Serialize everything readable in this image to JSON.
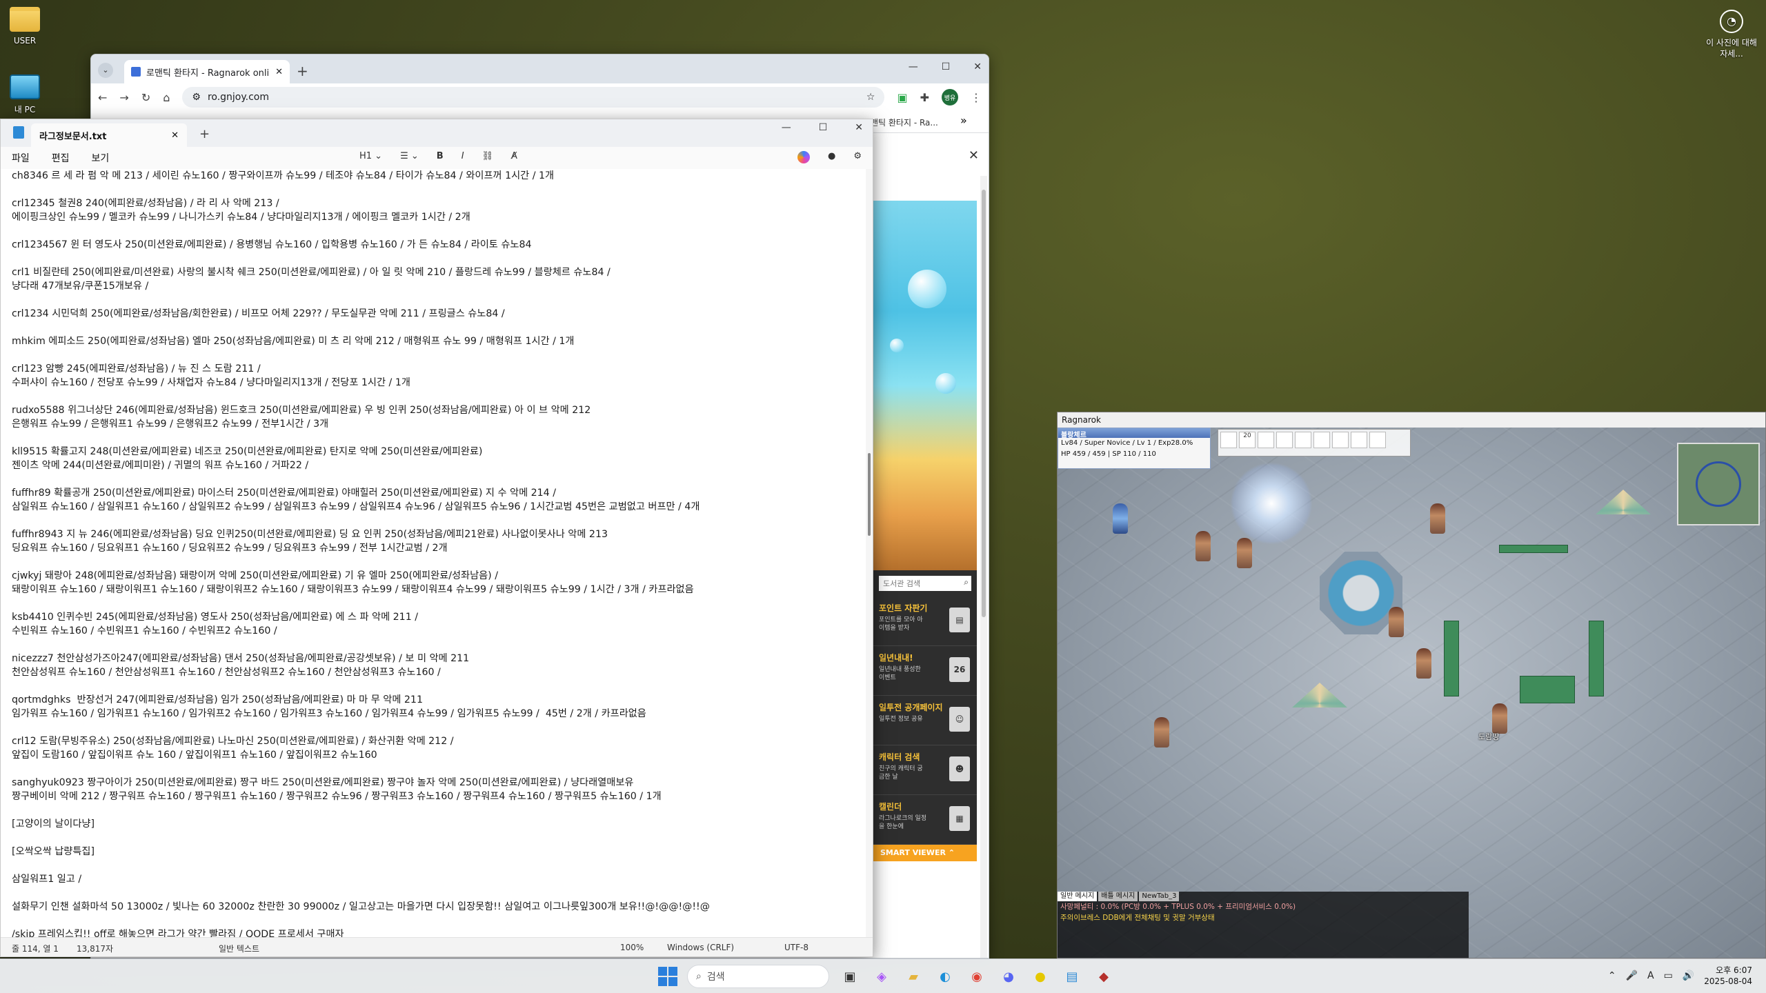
{
  "desktop": {
    "icons": [
      {
        "label": "USER",
        "icon": "folder-icon"
      },
      {
        "label": "내 PC",
        "icon": "pc-icon"
      }
    ],
    "photo_info": "이 사진에 대해 자세..."
  },
  "chrome": {
    "tab_title": "로맨틱 환타지 - Ragnarok onli",
    "url": "ro.gnjoy.com",
    "bookmark_tail": "맨틱 환타지 - Ra...",
    "profile": "병유",
    "side_search_placeholder": "도서관 검색",
    "side_menu": [
      {
        "label": "포인트 자판기",
        "desc": "포인트를 모아 아이템을 받자"
      },
      {
        "label": "일년내내!",
        "desc": "일년내내 풍성한 이벤트",
        "badge": "26"
      },
      {
        "label": "일투전 공개페이지",
        "desc": "일투전 정보 공유"
      },
      {
        "label": "캐릭터 검색",
        "desc": "친구의 캐릭터 궁금한 날"
      },
      {
        "label": "캘린더",
        "desc": "라그나로크의 일정을 한눈에"
      }
    ],
    "smart_viewer": "SMART VIEWER"
  },
  "notepad": {
    "tab_title": "라그정보문서.txt",
    "menu": [
      "파일",
      "편집",
      "보기"
    ],
    "format": {
      "heading": "H1",
      "bold": "B",
      "italic": "I"
    },
    "lines": [
      "ch8346 르 세 라 펌 악 메 213 / 세이린 슈노160 / 짱구와이프까 슈노99 / 테조야 슈노84 / 타이가 슈노84 / 와이프꺼 1시간 / 1개",
      "",
      "crl12345 철권8 240(에피완료/성좌남음) / 라 리 사 악메 213 /",
      "에이핑크상인 슈노99 / 멜코카 슈노99 / 나니가스키 슈노84 / 냥다마일리지13개 / 에이핑크 멜코카 1시간 / 2개",
      "",
      "crl1234567 윈 터 영도사 250(미션완료/에피완료) / 용병행님 슈노160 / 입학용병 슈노160 / 가 든 슈노84 / 라이토 슈노84",
      "",
      "crl1 비질란테 250(에피완료/미션완료) 사랑의 불시착 쉐크 250(미션완료/에피완료) / 아 일 릿 악메 210 / 플랑드레 슈노99 / 블랑체르 슈노84 /",
      "냥다래 47개보유/쿠폰15개보유 /",
      "",
      "crl1234 시민덕희 250(에피완료/성좌남음/회한완료) / 비프모 어체 229?? / 무도실무관 악메 211 / 프링글스 슈노84 /",
      "",
      "mhkim 에피소드 250(에피완료/성좌남음) 엘마 250(성좌남음/에피완료) 미 츠 리 악메 212 / 매형워프 슈노 99 / 매형워프 1시간 / 1개",
      "",
      "crl123 암빵 245(에피완료/성좌남음) / 뉴 진 스 도람 211 /",
      "수퍼샤이 슈노160 / 전당포 슈노99 / 사채업자 슈노84 / 냥다마일리지13개 / 전당포 1시간 / 1개",
      "",
      "rudxo5588 위그너상단 246(에피완료/성좌남음) 윈드호크 250(미션완료/에피완료) 우 빙 인퀴 250(성좌남음/에피완료) 아 이 브 악메 212",
      "은행워프 슈노99 / 은행워프1 슈노99 / 은행워프2 슈노99 / 전부1시간 / 3개",
      "",
      "kll9515 확률고지 248(미션완료/에피완료) 네즈코 250(미션완료/에피완료) 탄지로 악메 250(미션완료/에피완료)",
      "젠이츠 악메 244(미션완료/에피미완) / 귀멸의 워프 슈노160 / 거파22 /",
      "",
      "fuffhr89 확률공개 250(미션완료/에피완료) 마이스터 250(미션완료/에피완료) 야매힐러 250(미션완료/에피완료) 지 수 악메 214 /",
      "삼일워프 슈노160 / 삼일워프1 슈노160 / 삼일워프2 슈노99 / 삼일워프3 슈노99 / 삼일워프4 슈노96 / 삼일워프5 슈노96 / 1시간교범 45번은 교범없고 버프만 / 4개",
      "",
      "fuffhr8943 지 뉴 246(에피완료/성좌남음) 딩요 인퀴250(미션완료/에피완료) 딩 요 인퀴 250(성좌남음/에피21완료) 사나없이못사나 악메 213",
      "딩요워프 슈노160 / 딩요워프1 슈노160 / 딩요워프2 슈노99 / 딩요워프3 슈노99 / 전부 1시간교범 / 2개",
      "",
      "cjwkyj 돼랑아 248(에피완료/성좌남음) 돼랑이꺼 악메 250(미션완료/에피완료) 기 유 엘마 250(에피완료/성좌남음) /",
      "돼랑이워프 슈노160 / 돼랑이워프1 슈노160 / 돼랑이워프2 슈노160 / 돼랑이워프3 슈노99 / 돼랑이워프4 슈노99 / 돼랑이워프5 슈노99 / 1시간 / 3개 / 카프라없음",
      "",
      "ksb4410 인퀴수빈 245(에피완료/성좌남음) 영도사 250(성좌남음/에피완료) 에 스 파 악메 211 /",
      "수빈워프 슈노160 / 수빈워프1 슈노160 / 수빈워프2 슈노160 /",
      "",
      "nicezzz7 천안삼성가즈아247(에피완료/성좌남음) 댄서 250(성좌남음/에피완료/공강셋보유) / 보 미 악메 211",
      "천안삼성워프 슈노160 / 천안삼성워프1 슈노160 / 천안삼성워프2 슈노160 / 천안삼성워프3 슈노160 /",
      "",
      "qortmdghks  반장선거 247(에피완료/성좌남음) 임가 250(성좌남음/에피완료) 마 마 무 악메 211",
      "임가워프 슈노160 / 임가워프1 슈노160 / 임가워프2 슈노160 / 임가워프3 슈노160 / 임가워프4 슈노99 / 임가워프5 슈노99 /  45번 / 2개 / 카프라없음",
      "",
      "crl12 도람(무빙주유소) 250(성좌남음/에피완료) 나노마신 250(미션완료/에피완료) / 화산귀환 악메 212 /",
      "앞집이 도람160 / 앞집이워프 슈노 160 / 앞집이워프1 슈노160 / 앞집이워프2 슈노160",
      "",
      "sanghyuk0923 짱구아이가 250(미션완료/에피완료) 짱구 바드 250(미션완료/에피완료) 짱구야 놀자 악메 250(미션완료/에피완료) / 냥다래열매보유",
      "짱구베이비 악메 212 / 짱구워프 슈노160 / 짱구워프1 슈노160 / 짱구워프2 슈노96 / 짱구워프3 슈노160 / 짱구워프4 슈노160 / 짱구워프5 슈노160 / 1개",
      "",
      "[고양이의 날이다냥]",
      "",
      "[오싹오싹 납량특집]",
      "",
      "삼일워프1 일고 /",
      "",
      "설화무기 인챈 설화마석 50 13000z / 빛나는 60 32000z 찬란한 30 99000z / 일고상고는 마을가면 다시 입장못함!! 삼일여고 이그나릇잎300개 보유!!@!@@!@!!@",
      "",
      "/skip 프레임스킵!! off로 해놓으면 라그가 약간 빨라짐 / QODE 프로세서 구매자"
    ],
    "status": {
      "position": "줄 114, 열 1",
      "chars": "13,817자",
      "type": "일반 텍스트",
      "zoom": "100%",
      "eol": "Windows (CRLF)",
      "encoding": "UTF-8"
    }
  },
  "game": {
    "title": "Ragnarok",
    "char_name": "블랑체르",
    "char_info": "Lv84 / Super Novice / Lv 1 / Exp28.0%",
    "hp_sp": "HP 459 / 459 | SP 110 / 110",
    "hotbar_count": "20",
    "player_label": "도람땅",
    "chat_tabs": [
      "일반 메시지",
      "배틀 메시지",
      "NewTab_3"
    ],
    "chat_lines": [
      "사망페널티 : 0.0% (PC방 0.0% + TPLUS 0.0% + 프리미엄서비스 0.0%)",
      "주의이브레스 DDB에게 전체채팅 및 귓말 거부상태"
    ]
  },
  "taskbar": {
    "search_placeholder": "검색",
    "time": "오후 6:07",
    "date": "2025-08-04",
    "ime": "A"
  }
}
